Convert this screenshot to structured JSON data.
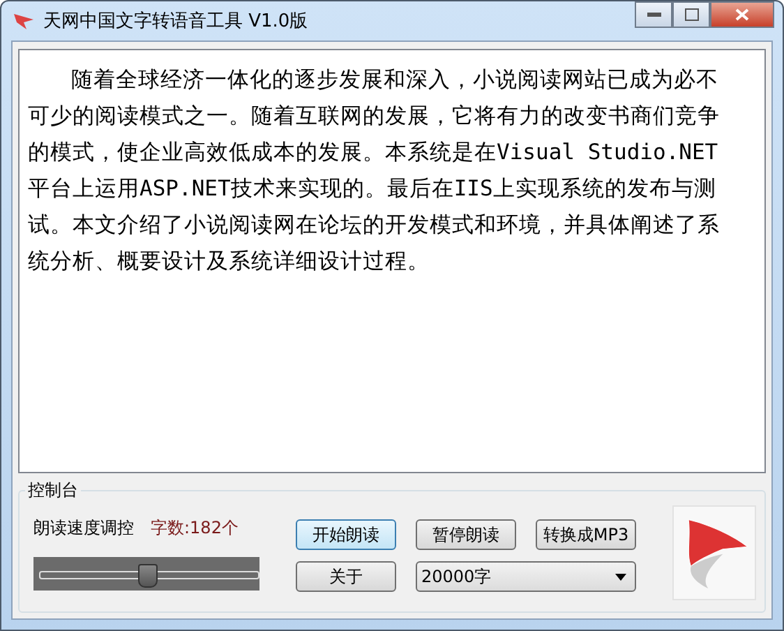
{
  "window": {
    "title": "天网中国文字转语音工具 V1.0版"
  },
  "content": {
    "text": "随着全球经济一体化的逐步发展和深入，小说阅读网站已成为必不可少的阅读模式之一。随着互联网的发展，它将有力的改变书商们竞争的模式，使企业高效低成本的发展。本系统是在Visual Studio.NET平台上运用ASP.NET技术来实现的。最后在IIS上实现系统的发布与测试。本文介绍了小说阅读网在论坛的开发模式和环境，并具体阐述了系统分析、概要设计及系统详细设计过程。"
  },
  "control_panel": {
    "title": "控制台",
    "speed_label": "朗读速度调控",
    "char_count": "字数:182个",
    "speed": {
      "level": 0.5
    },
    "buttons": [
      {
        "label": "开始朗读",
        "selected": true
      },
      {
        "label": "暂停朗读",
        "selected": false
      },
      {
        "label": "转换成MP3",
        "selected": false
      },
      {
        "label": "关于",
        "selected": false
      }
    ],
    "limit": {
      "value": "20000字"
    }
  }
}
